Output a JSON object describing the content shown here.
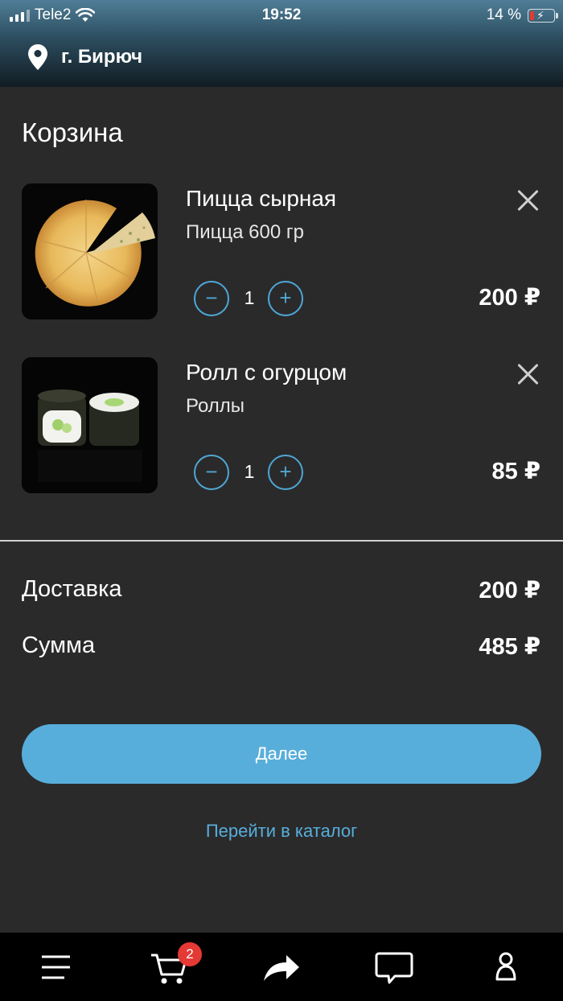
{
  "status_bar": {
    "carrier": "Tele2",
    "time": "19:52",
    "battery": "14 %",
    "battery_level": 0.14
  },
  "header": {
    "location": "г. Бирюч",
    "location_icon": "map-pin-icon"
  },
  "page": {
    "title": "Корзина"
  },
  "cart": {
    "items": [
      {
        "name": "Пицца сырная",
        "description": "Пицца 600 гр",
        "quantity": "1",
        "price": "200 ₽"
      },
      {
        "name": "Ролл с огурцом",
        "description": "Роллы",
        "quantity": "1",
        "price": "85 ₽"
      }
    ],
    "minus_symbol": "−",
    "plus_symbol": "+"
  },
  "summary": {
    "delivery_label": "Доставка",
    "delivery_value": "200 ₽",
    "total_label": "Сумма",
    "total_value": "485 ₽"
  },
  "actions": {
    "next_label": "Далее",
    "catalog_link": "Перейти в каталог"
  },
  "tab_bar": {
    "cart_badge": "2",
    "icons": [
      "menu-icon",
      "cart-icon",
      "share-icon",
      "chat-icon",
      "profile-icon"
    ]
  },
  "colors": {
    "accent": "#58aedb",
    "background": "#2a2a2b",
    "badge": "#e53935"
  }
}
